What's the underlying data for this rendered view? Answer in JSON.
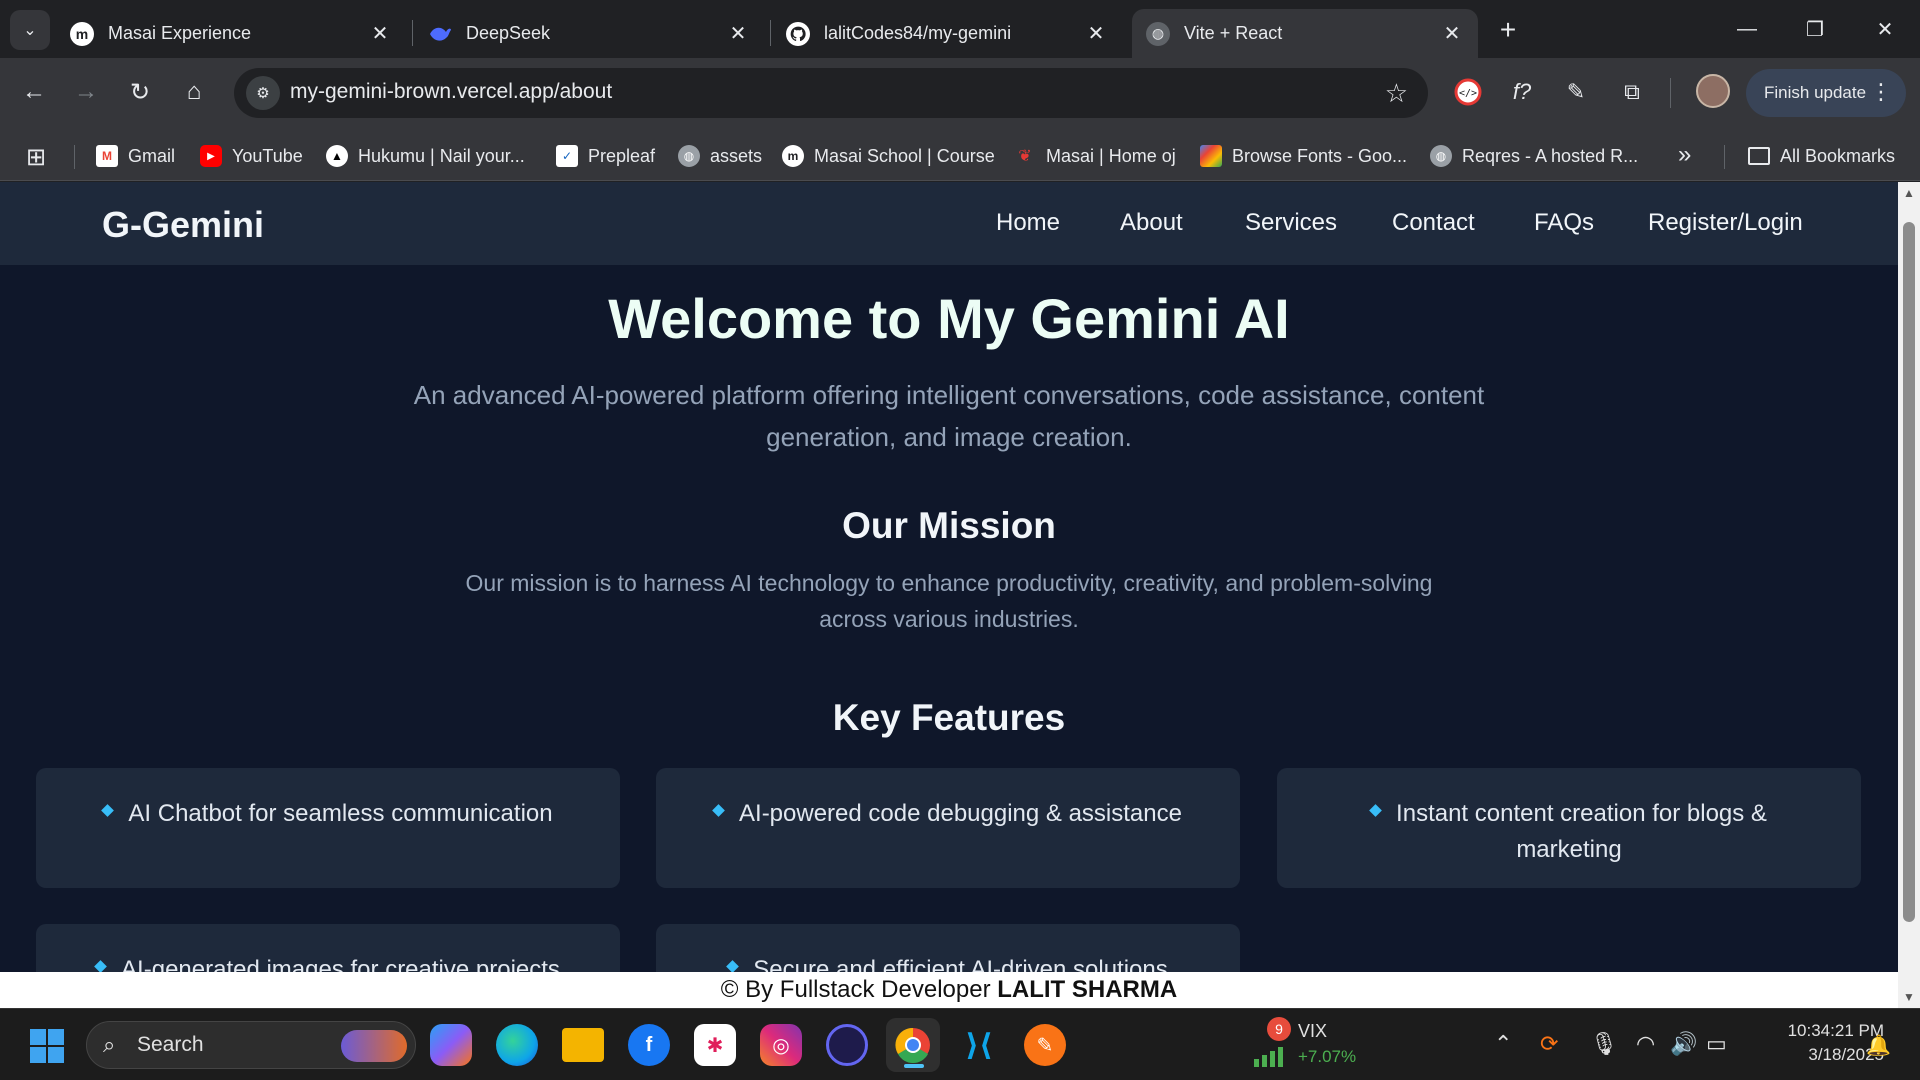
{
  "browser": {
    "tabs": [
      {
        "title": "Masai Experience",
        "icon": "masai-icon",
        "active": false
      },
      {
        "title": "DeepSeek",
        "icon": "deepseek-icon",
        "active": false
      },
      {
        "title": "lalitCodes84/my-gemini",
        "icon": "github-icon",
        "active": false
      },
      {
        "title": "Vite + React",
        "icon": "globe-icon",
        "active": true
      }
    ],
    "url": "my-gemini-brown.vercel.app/about",
    "update_button": "Finish update",
    "bookmarks": [
      {
        "label": "Gmail",
        "icon": "gmail-icon"
      },
      {
        "label": "YouTube",
        "icon": "youtube-icon"
      },
      {
        "label": "Hukumu | Nail your...",
        "icon": "hukumu-icon"
      },
      {
        "label": "Prepleaf",
        "icon": "prepleaf-icon"
      },
      {
        "label": "assets",
        "icon": "globe-icon"
      },
      {
        "label": "Masai School | Course",
        "icon": "masai-icon"
      },
      {
        "label": "Masai | Home oj",
        "icon": "masai-oj-icon"
      },
      {
        "label": "Browse Fonts - Goo...",
        "icon": "google-fonts-icon"
      },
      {
        "label": "Reqres - A hosted R...",
        "icon": "globe-icon"
      }
    ],
    "all_bookmarks": "All Bookmarks"
  },
  "site": {
    "brand": "G-Gemini",
    "nav": [
      "Home",
      "About",
      "Services",
      "Contact",
      "FAQs",
      "Register/Login"
    ],
    "hero_title": "Welcome to My Gemini AI",
    "hero_subtitle": "An advanced AI-powered platform offering intelligent conversations, code assistance, content generation, and image creation.",
    "mission_title": "Our Mission",
    "mission_text": "Our mission is to harness AI technology to enhance productivity, creativity, and problem-solving across various industries.",
    "features_title": "Key Features",
    "features": [
      "AI Chatbot for seamless communication",
      "AI-powered code debugging & assistance",
      "Instant content creation for blogs & marketing",
      "AI-generated images for creative projects",
      "Secure and efficient AI-driven solutions"
    ],
    "footer_prefix": "© By Fullstack Developer",
    "footer_name": "LALIT SHARMA"
  },
  "taskbar": {
    "search_placeholder": "Search",
    "widget": {
      "badge": "9",
      "label": "VIX",
      "change": "+7.07%"
    },
    "time": "10:34:21 PM",
    "date": "3/18/2025"
  },
  "colors": {
    "page_bg": "#0f172a",
    "nav_bg": "#1e293b",
    "card_bg": "#1e293b",
    "bullet": "#38bdf8"
  }
}
